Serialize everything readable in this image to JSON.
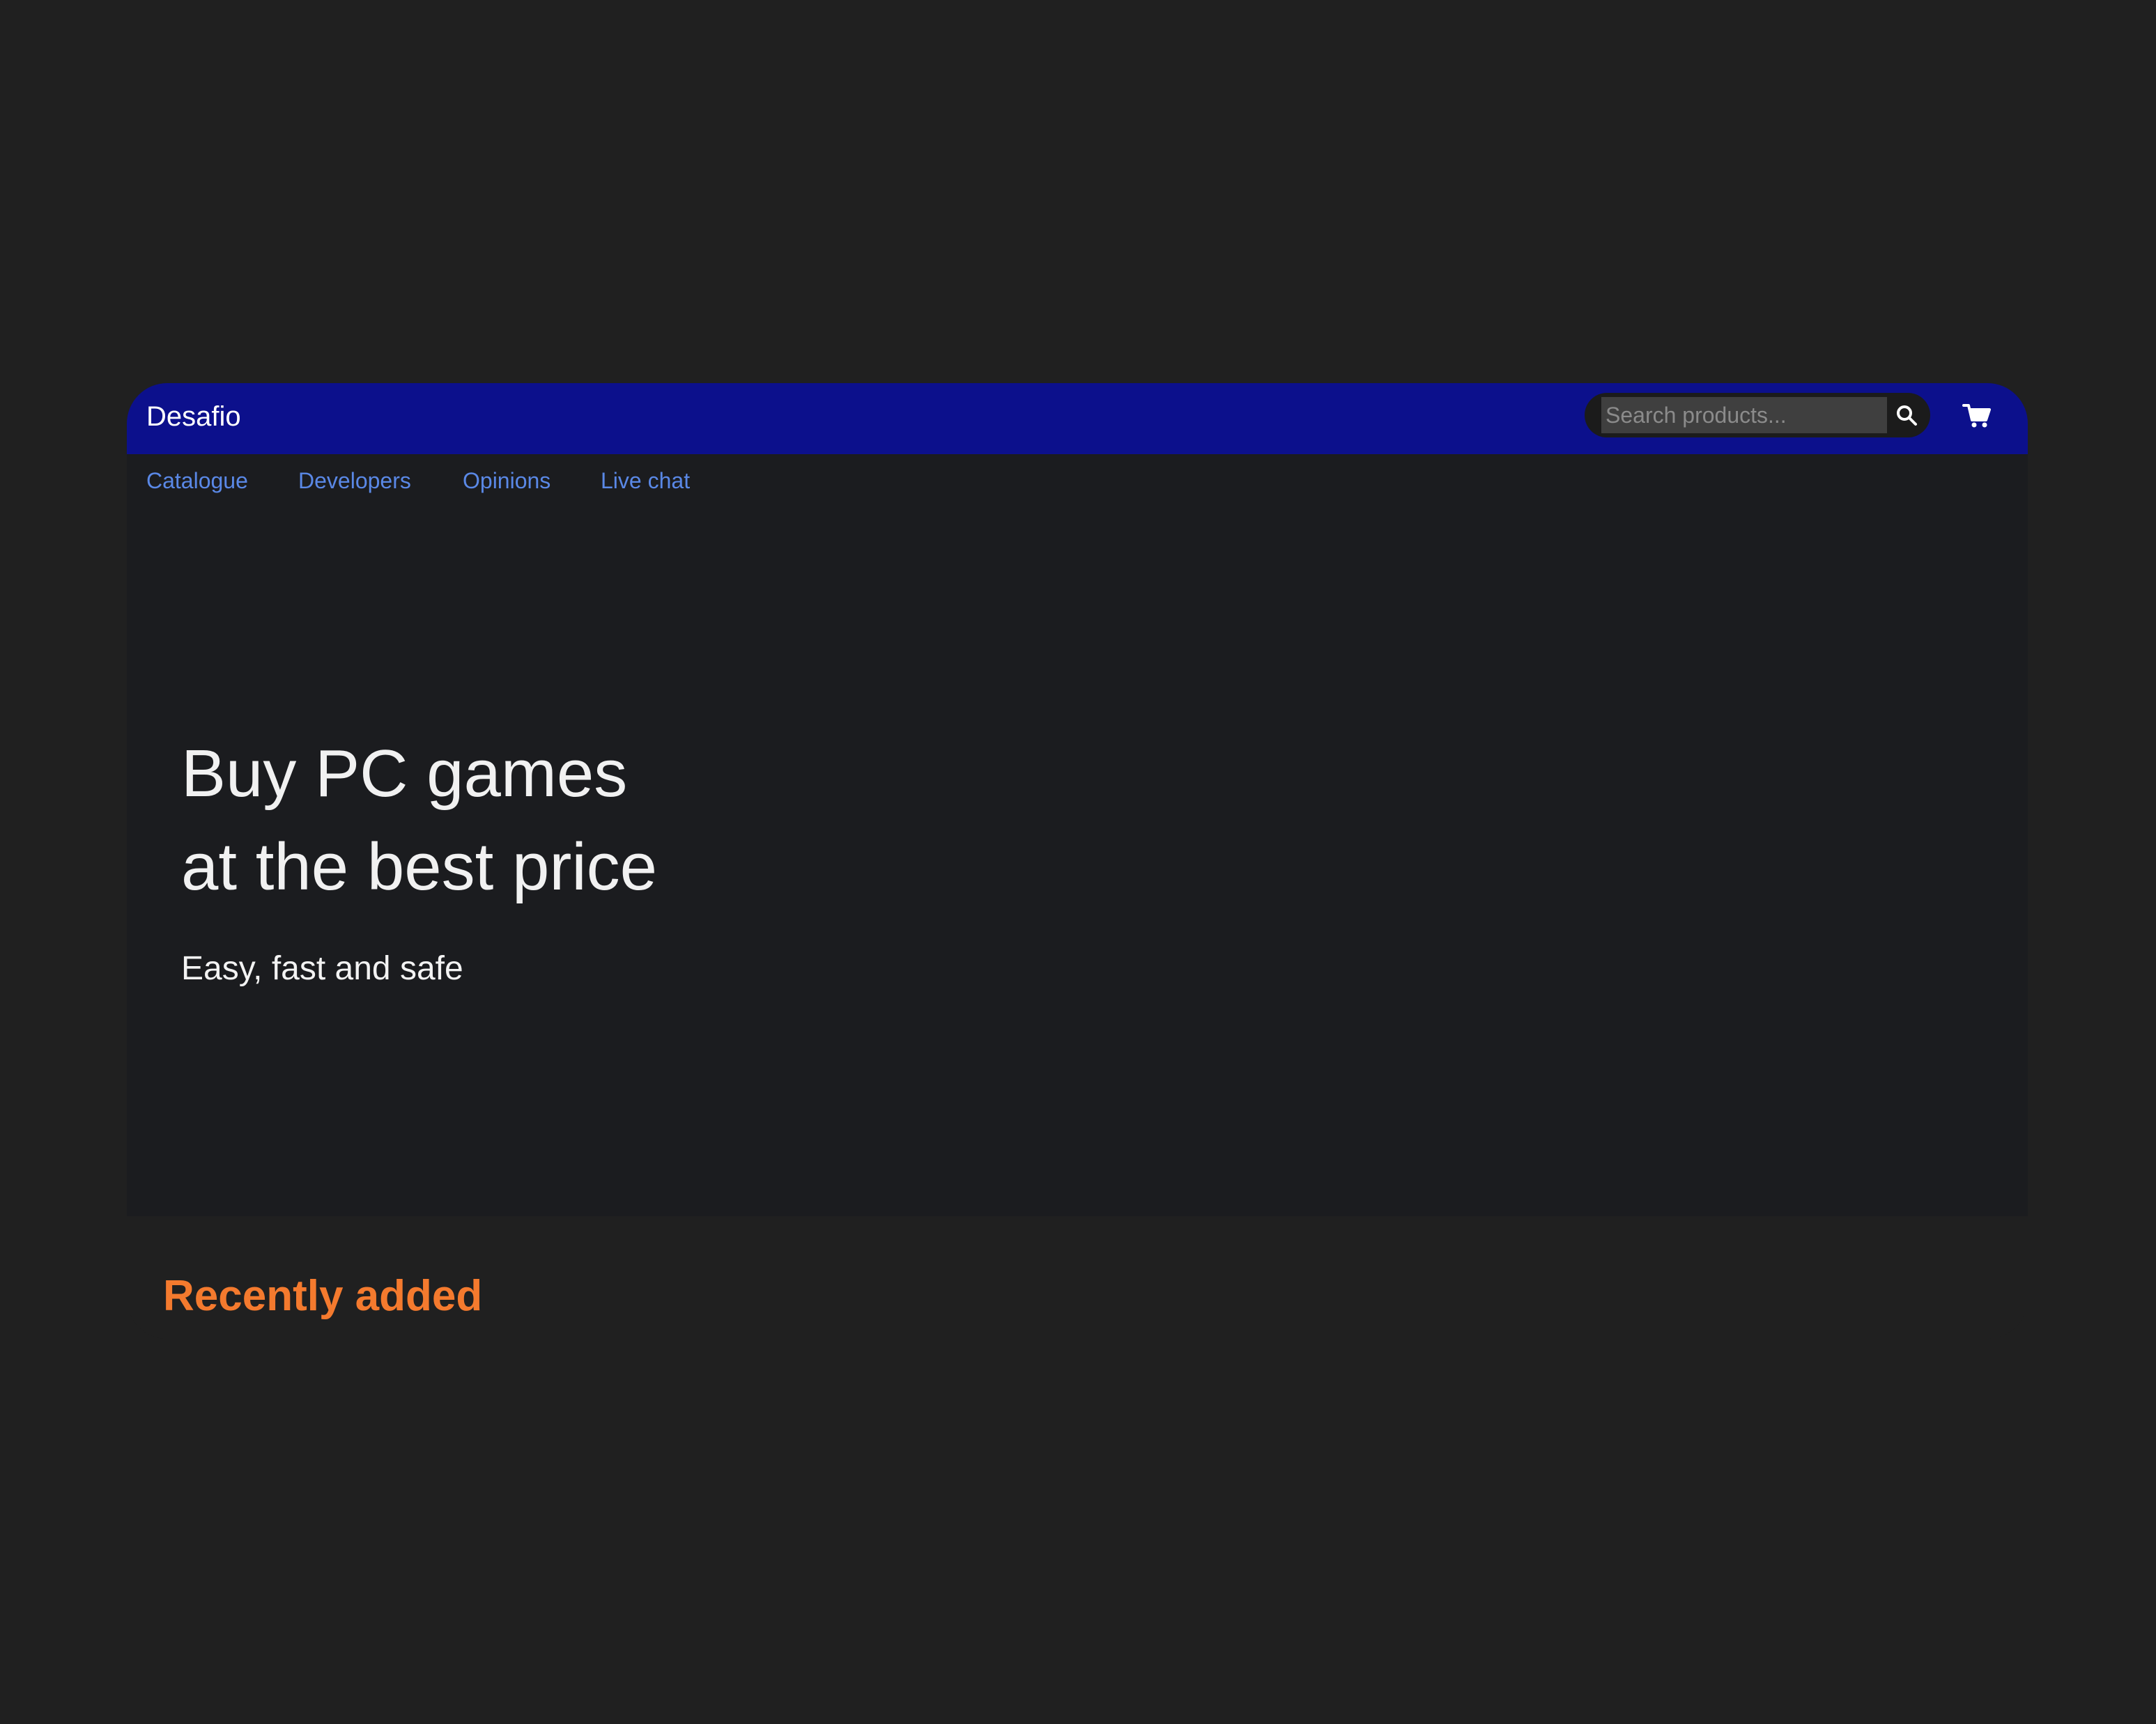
{
  "site": {
    "brand": "Desafio"
  },
  "header": {
    "search": {
      "placeholder": "Search products...",
      "value": ""
    },
    "icons": {
      "search": "search-icon",
      "cart": "cart-icon"
    }
  },
  "nav": {
    "items": [
      {
        "label": "Catalogue"
      },
      {
        "label": "Developers"
      },
      {
        "label": "Opinions"
      },
      {
        "label": "Live chat"
      }
    ]
  },
  "hero": {
    "title": "Buy PC games\nat the best price",
    "subtitle": "Easy, fast and safe"
  },
  "recent": {
    "title": "Recently added"
  },
  "colors": {
    "page_background": "#202020",
    "header_background": "#0c108c",
    "content_background": "#1b1c1f",
    "nav_link": "#5a88e6",
    "accent": "#f47a2e",
    "text_primary": "#f1f1f1"
  }
}
